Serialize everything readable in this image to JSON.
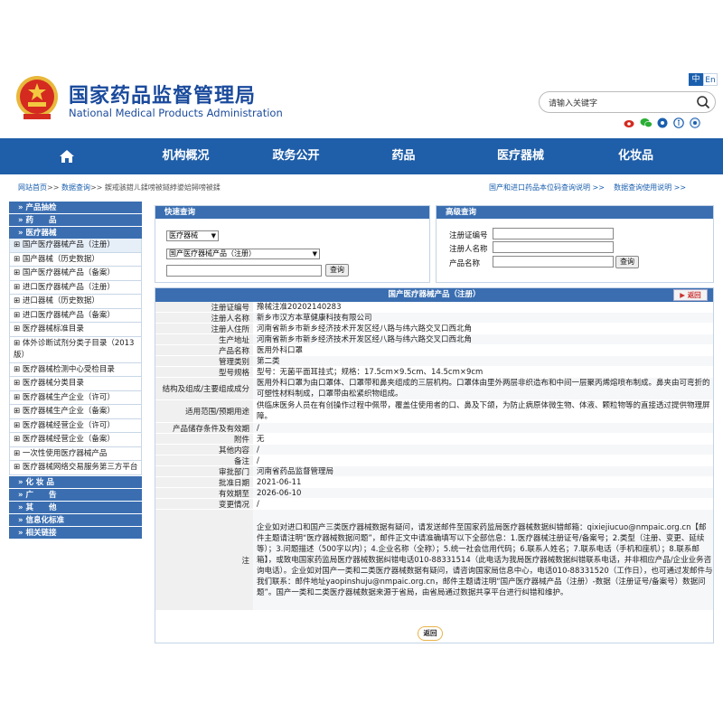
{
  "header": {
    "title_cn": "国家药品监督管理局",
    "title_en": "National Medical Products Administration",
    "lang_active": "中",
    "lang_other": "En",
    "search_placeholder": "请输入关键字"
  },
  "nav": {
    "items": [
      "机构概况",
      "政务公开",
      "药品",
      "医疗器械",
      "化妆品"
    ]
  },
  "breadcrumb": {
    "home": "网站首页",
    "sep1": ">>",
    "query": "数据查询",
    "sep2": ">>",
    "current": "鍥戒骇鍣ㄦ鍒嗙被鐩綍鍙婄鐞嗙被鍒",
    "right1": "国产和进口药品本位码查询说明 >>",
    "right2": "数据查询使用说明 >>"
  },
  "sidebar": {
    "cat_products": "» 产品抽检",
    "cat_drugs": "» 药　　品",
    "cat_devices": "» 医疗器械",
    "items": [
      "国产医疗器械产品（注册）",
      "国产器械（历史数据）",
      "国产医疗器械产品（备案）",
      "进口医疗器械产品（注册）",
      "进口器械（历史数据）",
      "进口医疗器械产品（备案）",
      "医疗器械标准目录",
      "体外诊断试剂分类子目录（2013版）",
      "医疗器械检测中心受检目录",
      "医疗器械分类目录",
      "医疗器械生产企业（许可）",
      "医疗器械生产企业（备案）",
      "医疗器械经营企业（许可）",
      "医疗器械经营企业（备案）",
      "一次性使用医疗器械产品",
      "医疗器械网络交易服务第三方平台"
    ],
    "cat_cosmetics": "» 化 妆 品",
    "cat_ads": "» 广　　告",
    "cat_other": "» 其　　他",
    "cat_info": "» 信息化标准",
    "cat_links": "» 相关链接"
  },
  "quick": {
    "title": "快速查询",
    "select1": "医疗器械",
    "select2": "国产医疗器械产品（注册）",
    "button": "查询"
  },
  "advanced": {
    "title": "高级查询",
    "label1": "注册证编号",
    "label2": "注册人名称",
    "label3": "产品名称",
    "button": "查询"
  },
  "detail": {
    "title": "国产医疗器械产品（注册）",
    "back_label": "返回",
    "rows": [
      {
        "k": "注册证编号",
        "v": "豫械注准20202140283"
      },
      {
        "k": "注册人名称",
        "v": "新乡市汉方本草健康科技有限公司"
      },
      {
        "k": "注册人住所",
        "v": "河南省新乡市新乡经济技术开发区经八路与纬六路交叉口西北角"
      },
      {
        "k": "生产地址",
        "v": "河南省新乡市新乡经济技术开发区经八路与纬六路交叉口西北角"
      },
      {
        "k": "产品名称",
        "v": "医用外科口罩"
      },
      {
        "k": "管理类别",
        "v": "第二类"
      },
      {
        "k": "型号规格",
        "v": "型号：无菌平面耳挂式；规格：17.5cm×9.5cm、14.5cm×9cm"
      },
      {
        "k": "结构及组成/主要组成成分",
        "v": "医用外科口罩为由口罩体、口罩带和鼻夹组成的三层机构。口罩体由里外两层非织造布和中间一层聚丙烯熔喷布制成。鼻夹由可弯折的可塑性材料制成，口罩带由松紧织物组成。"
      },
      {
        "k": "适用范围/预期用途",
        "v": "供临床医务人员在有创操作过程中佩带，覆盖住使用者的口、鼻及下颌，为防止病原体微生物、体液、颗粒物等的直接透过提供物理屏障。"
      },
      {
        "k": "产品储存条件及有效期",
        "v": "/"
      },
      {
        "k": "附件",
        "v": "无"
      },
      {
        "k": "其他内容",
        "v": "/"
      },
      {
        "k": "备注",
        "v": "/"
      },
      {
        "k": "审批部门",
        "v": "河南省药品监督管理局"
      },
      {
        "k": "批准日期",
        "v": "2021-06-11"
      },
      {
        "k": "有效期至",
        "v": "2026-06-10"
      },
      {
        "k": "变更情况",
        "v": "/"
      },
      {
        "k": "注",
        "v": "企业如对进口和国产三类医疗器械数据有疑问，请发送邮件至国家药监局医疗器械数据纠错邮箱：qixiejiucuo@nmpaic.org.cn【邮件主题请注明“医疗器械数据问题”，邮件正文中请准确填写以下全部信息：1.医疗器械注册证号/备案号；2.类型（注册、变更、延续等）；3.问题描述（500字以内）；4.企业名称（全称）；5.统一社会信用代码；6.联系人姓名；7.联系电话（手机和座机）；8.联系邮箱】，或致电国家药监局医疗器械数据纠错电话010-88331514（此电话为我局医疗器械数据纠错联系电话，并非相应产品/企业业务咨询电话）。企业如对国产一类和二类医疗器械数据有疑问，请咨询国家局信息中心，电话010-88331520（工作日），也可通过发邮件与我们联系：邮件地址yaopinshuju@nmpaic.org.cn，邮件主题请注明“国产医疗器械产品（注册）-数据（注册证号/备案号）数据问题”。国产一类和二类医疗器械数据来源于省局，由省局通过数据共享平台进行纠错和维护。"
      }
    ],
    "bottom_back": "返回"
  },
  "colors": {
    "primary": "#1f5ea8",
    "section": "#3a6eb1",
    "title": "#1a4a9c",
    "link": "#1a5fae"
  }
}
